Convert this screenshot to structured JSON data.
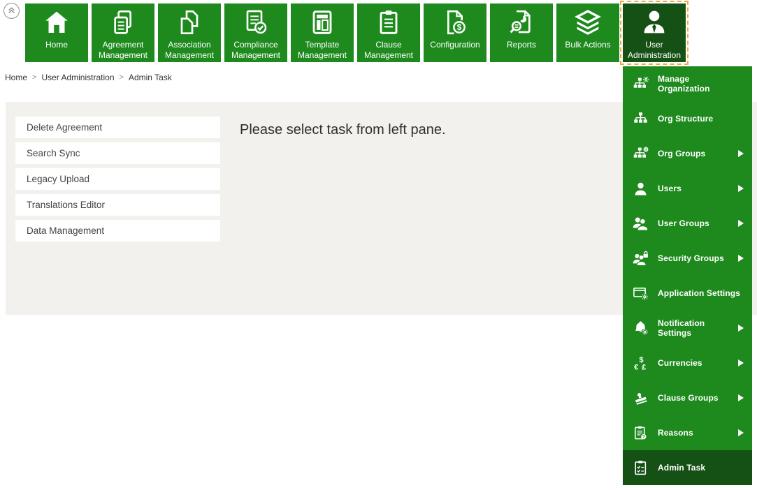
{
  "topbar": {
    "collapse_button": {
      "icon": "collapse-chevrons-icon"
    },
    "tiles": [
      {
        "label": "Home",
        "icon": "home-icon",
        "selected": false
      },
      {
        "label": "Agreement Management",
        "icon": "agreement-management-icon",
        "selected": false
      },
      {
        "label": "Association Management",
        "icon": "association-management-icon",
        "selected": false
      },
      {
        "label": "Compliance Management",
        "icon": "compliance-management-icon",
        "selected": false
      },
      {
        "label": "Template Management",
        "icon": "template-management-icon",
        "selected": false
      },
      {
        "label": "Clause Management",
        "icon": "clause-management-icon",
        "selected": false
      },
      {
        "label": "Configuration",
        "icon": "configuration-icon",
        "selected": false
      },
      {
        "label": "Reports",
        "icon": "reports-icon",
        "selected": false
      },
      {
        "label": "Bulk Actions",
        "icon": "bulk-actions-icon",
        "selected": false
      },
      {
        "label": "User Administration",
        "icon": "user-administration-icon",
        "selected": true
      }
    ]
  },
  "breadcrumb": {
    "separator": ">",
    "items": [
      "Home",
      "User Administration",
      "Admin Task"
    ]
  },
  "task_pane": {
    "items": [
      "Delete Agreement",
      "Search Sync",
      "Legacy Upload",
      "Translations Editor",
      "Data Management"
    ]
  },
  "main": {
    "message": "Please select task from left pane."
  },
  "user_admin_menu": {
    "items": [
      {
        "label": "Manage Organization",
        "icon": "manage-organization-icon",
        "has_submenu": false,
        "selected": false
      },
      {
        "label": "Org Structure",
        "icon": "org-structure-icon",
        "has_submenu": false,
        "selected": false
      },
      {
        "label": "Org Groups",
        "icon": "org-groups-icon",
        "has_submenu": true,
        "selected": false
      },
      {
        "label": "Users",
        "icon": "users-icon",
        "has_submenu": true,
        "selected": false
      },
      {
        "label": "User Groups",
        "icon": "user-groups-icon",
        "has_submenu": true,
        "selected": false
      },
      {
        "label": "Security Groups",
        "icon": "security-groups-icon",
        "has_submenu": true,
        "selected": false
      },
      {
        "label": "Application Settings",
        "icon": "application-settings-icon",
        "has_submenu": false,
        "selected": false
      },
      {
        "label": "Notification Settings",
        "icon": "notification-settings-icon",
        "has_submenu": true,
        "selected": false
      },
      {
        "label": "Currencies",
        "icon": "currencies-icon",
        "has_submenu": true,
        "selected": false
      },
      {
        "label": "Clause Groups",
        "icon": "clause-groups-icon",
        "has_submenu": true,
        "selected": false
      },
      {
        "label": "Reasons",
        "icon": "reasons-icon",
        "has_submenu": true,
        "selected": false
      },
      {
        "label": "Admin Task",
        "icon": "admin-task-icon",
        "has_submenu": false,
        "selected": true
      }
    ]
  },
  "colors": {
    "green": "#1e8a1e",
    "dark_green": "#155115",
    "selection_border": "#edaa3d",
    "panel_gray": "#f2f1ee"
  }
}
